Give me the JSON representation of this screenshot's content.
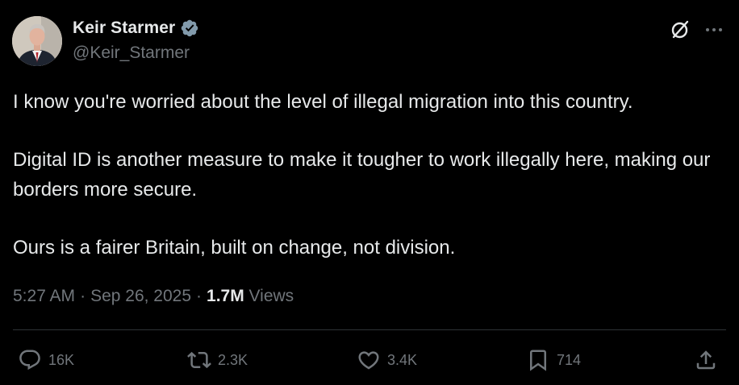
{
  "author": {
    "display_name": "Keir Starmer",
    "handle": "@Keir_Starmer",
    "verified": true
  },
  "tweet": {
    "paragraphs": [
      "I know you're worried about the level of illegal migration into this country.",
      "Digital ID is another measure to make it tougher to work illegally here, making our borders more secure.",
      "Ours is a fairer Britain, built on change, not division."
    ]
  },
  "meta": {
    "time": "5:27 AM",
    "separator": "·",
    "date": "Sep 26, 2025",
    "views_count": "1.7M",
    "views_label": "Views"
  },
  "actions": {
    "replies": "16K",
    "reposts": "2.3K",
    "likes": "3.4K",
    "bookmarks": "714"
  },
  "icons": {
    "verified": "verified-badge-icon",
    "grok": "grok-icon",
    "more": "more-icon",
    "reply": "reply-icon",
    "repost": "repost-icon",
    "like": "heart-icon",
    "bookmark": "bookmark-icon",
    "share": "share-icon"
  },
  "colors": {
    "background": "#000000",
    "text_primary": "#e7e9ea",
    "text_secondary": "#71767b",
    "divider": "#2f3336",
    "verified_badge": "#829aab"
  }
}
